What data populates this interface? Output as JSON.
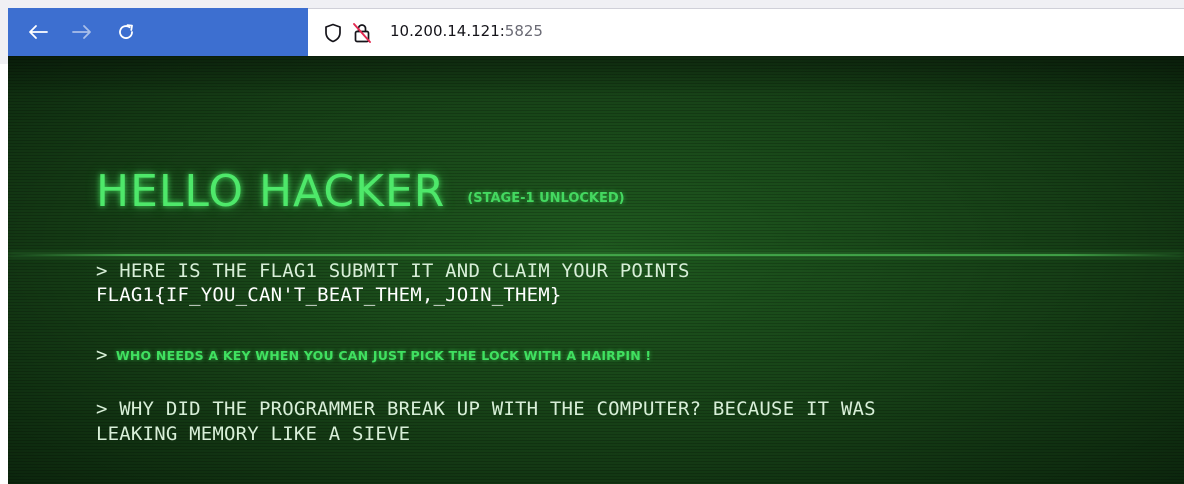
{
  "browser": {
    "url_host": "10.200.14.121:",
    "url_port": "5825",
    "back_icon": "arrow-left-icon",
    "forward_icon": "arrow-right-icon",
    "reload_icon": "reload-icon",
    "shield_icon": "shield-icon",
    "lock_icon": "insecure-lock-icon",
    "toolbar_color": "#3d6fd0"
  },
  "page": {
    "title": "HELLO HACKER",
    "subtitle": "(STAGE-1 UNLOCKED)",
    "line1": "> HERE IS THE FLAG1 SUBMIT IT AND CLAIM YOUR POINTS",
    "flag": "FLAG1{IF_YOU_CAN'T_BEAT_THEM,_JOIN_THEM}",
    "line3_prompt": ">",
    "line3_text": "WHO NEEDS A KEY WHEN YOU CAN JUST PICK THE LOCK WITH A HAIRPIN !",
    "line4_a": "> WHY DID THE PROGRAMMER BREAK UP WITH THE COMPUTER? BECAUSE IT WAS",
    "line4_b": "LEAKING MEMORY LIKE A SIEVE",
    "accent_color": "#4ee86a",
    "background_color": "#163f16"
  }
}
